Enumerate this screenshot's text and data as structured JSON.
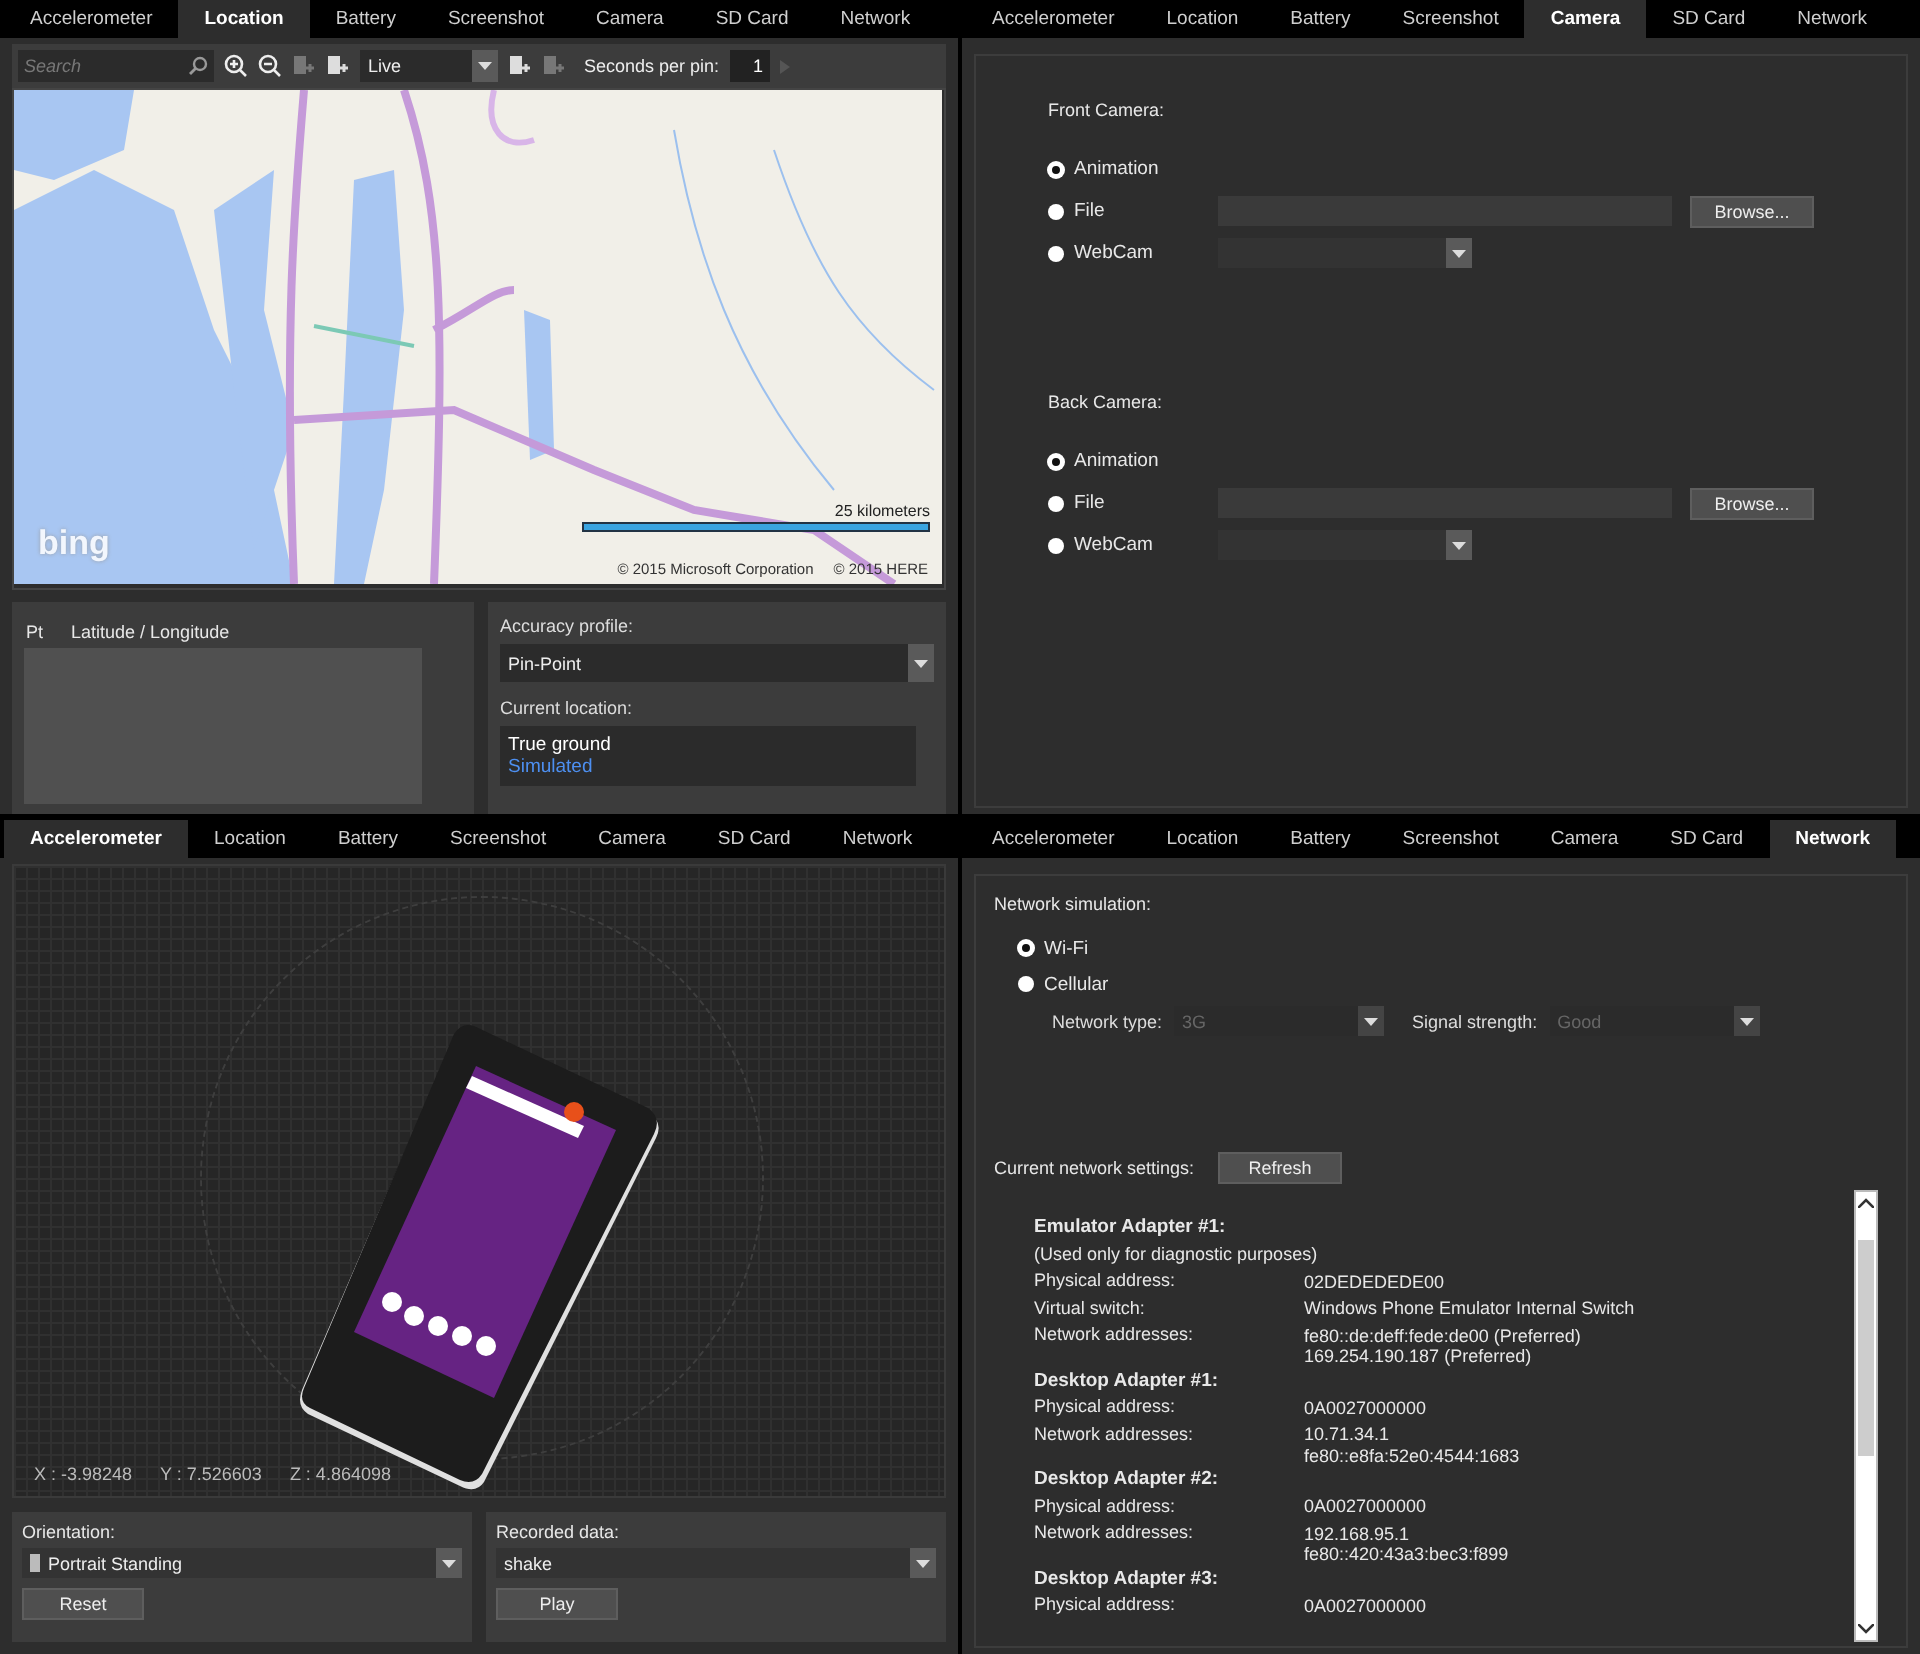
{
  "location_pane": {
    "tabs": [
      {
        "label": "Accelerometer",
        "selected": false
      },
      {
        "label": "Location",
        "selected": true
      },
      {
        "label": "Battery",
        "selected": false
      },
      {
        "label": "Screenshot",
        "selected": false
      },
      {
        "label": "Camera",
        "selected": false
      },
      {
        "label": "SD Card",
        "selected": false
      },
      {
        "label": "Network",
        "selected": false
      }
    ],
    "toolbar": {
      "search": {
        "placeholder": "Search"
      },
      "mode": {
        "value": "Live"
      },
      "seconds_per_pin": {
        "label": "Seconds per pin:",
        "value": "1"
      }
    },
    "map": {
      "logo": "bing",
      "scale": "25 kilometers",
      "copyrights": [
        "© 2015 Microsoft Corporation",
        "© 2015 HERE"
      ]
    },
    "pins_table": {
      "columns": [
        "Pt",
        "Latitude / Longitude"
      ]
    },
    "accuracy_profile": {
      "label": "Accuracy profile:",
      "value": "Pin-Point"
    },
    "current_location": {
      "label": "Current location:",
      "legend": [
        {
          "text": "True ground",
          "color": "#ffffff"
        },
        {
          "text": "Simulated",
          "color": "#4d8ff0"
        }
      ]
    }
  },
  "camera_pane": {
    "tabs": [
      {
        "label": "Accelerometer",
        "selected": false
      },
      {
        "label": "Location",
        "selected": false
      },
      {
        "label": "Battery",
        "selected": false
      },
      {
        "label": "Screenshot",
        "selected": false
      },
      {
        "label": "Camera",
        "selected": true
      },
      {
        "label": "SD Card",
        "selected": false
      },
      {
        "label": "Network",
        "selected": false
      }
    ],
    "sections": [
      {
        "title": "Front Camera:",
        "options": [
          {
            "label": "Animation",
            "selected": true,
            "kind": "plain"
          },
          {
            "label": "File",
            "selected": false,
            "kind": "file"
          },
          {
            "label": "WebCam",
            "selected": false,
            "kind": "device"
          }
        ],
        "browse": "Browse..."
      },
      {
        "title": "Back Camera:",
        "options": [
          {
            "label": "Animation",
            "selected": true,
            "kind": "plain"
          },
          {
            "label": "File",
            "selected": false,
            "kind": "file"
          },
          {
            "label": "WebCam",
            "selected": false,
            "kind": "device"
          }
        ],
        "browse": "Browse..."
      }
    ]
  },
  "accelerometer_pane": {
    "tabs": [
      {
        "label": "Accelerometer",
        "selected": true
      },
      {
        "label": "Location",
        "selected": false
      },
      {
        "label": "Battery",
        "selected": false
      },
      {
        "label": "Screenshot",
        "selected": false
      },
      {
        "label": "Camera",
        "selected": false
      },
      {
        "label": "SD Card",
        "selected": false
      },
      {
        "label": "Network",
        "selected": false
      }
    ],
    "readouts": [
      "X : -3.98248",
      "Y : 7.526603",
      "Z : 4.864098"
    ],
    "orientation": {
      "label": "Orientation:",
      "value": "Portrait Standing",
      "button": "Reset"
    },
    "recorded_data": {
      "label": "Recorded data:",
      "value": "shake",
      "button": "Play"
    }
  },
  "network_pane": {
    "tabs": [
      {
        "label": "Accelerometer",
        "selected": false
      },
      {
        "label": "Location",
        "selected": false
      },
      {
        "label": "Battery",
        "selected": false
      },
      {
        "label": "Screenshot",
        "selected": false
      },
      {
        "label": "Camera",
        "selected": false
      },
      {
        "label": "SD Card",
        "selected": false
      },
      {
        "label": "Network",
        "selected": true
      }
    ],
    "simulation_label": "Network simulation:",
    "options": [
      {
        "label": "Wi-Fi",
        "selected": true
      },
      {
        "label": "Cellular",
        "selected": false
      }
    ],
    "dropdowns": [
      {
        "label": "Network type:",
        "value": "3G",
        "disabled": true
      },
      {
        "label": "Signal strength:",
        "value": "Good",
        "disabled": true
      }
    ],
    "settings_label": "Current network settings:",
    "refresh": "Refresh",
    "adapters": [
      {
        "title": "Emulator Adapter #1:",
        "note": "(Used only for diagnostic purposes)",
        "rows": [
          {
            "label": "Physical address:",
            "values": [
              "02DEDEDEDE00"
            ]
          },
          {
            "label": "Virtual switch:",
            "values": [
              "Windows Phone Emulator Internal Switch"
            ]
          },
          {
            "label": "Network addresses:",
            "values": [
              "fe80::de:deff:fede:de00 (Preferred)",
              "169.254.190.187 (Preferred)"
            ]
          }
        ]
      },
      {
        "title": "Desktop Adapter #1:",
        "rows": [
          {
            "label": "Physical address:",
            "values": [
              "0A0027000000"
            ]
          },
          {
            "label": "Network addresses:",
            "values": [
              "10.71.34.1",
              "fe80::e8fa:52e0:4544:1683"
            ]
          }
        ]
      },
      {
        "title": "Desktop Adapter #2:",
        "rows": [
          {
            "label": "Physical address:",
            "values": [
              "0A0027000000"
            ]
          },
          {
            "label": "Network addresses:",
            "values": [
              "192.168.95.1",
              "fe80::420:43a3:bec3:f899"
            ]
          }
        ]
      },
      {
        "title": "Desktop Adapter #3:",
        "rows": [
          {
            "label": "Physical address:",
            "values": [
              "0A0027000000"
            ]
          }
        ]
      }
    ]
  }
}
